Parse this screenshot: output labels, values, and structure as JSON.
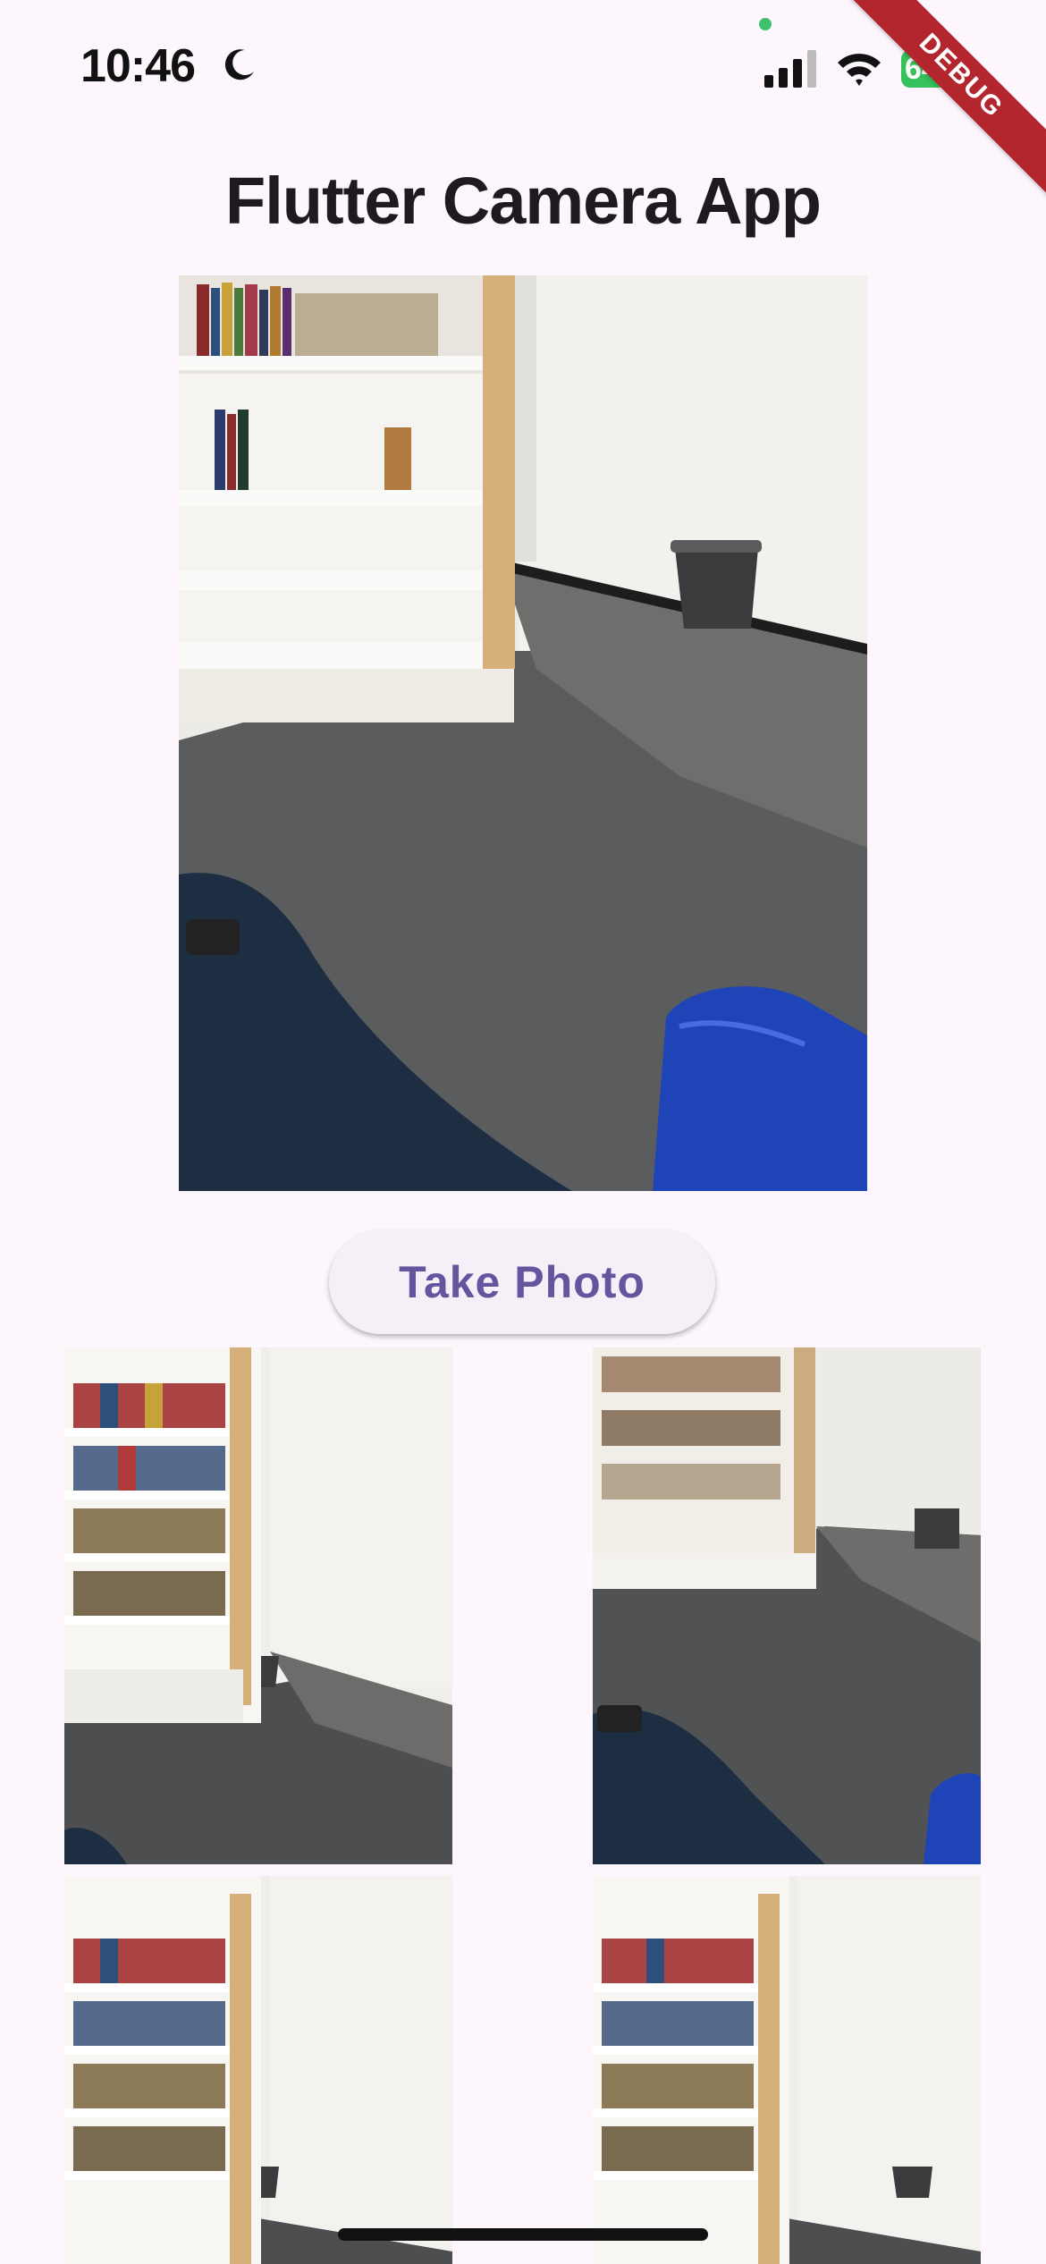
{
  "status_bar": {
    "time": "10:46",
    "battery_percent": "64",
    "battery_level": 0.64,
    "icons": [
      "moon-icon",
      "signal-icon",
      "wifi-icon",
      "battery-icon"
    ],
    "colors": {
      "battery_fill": "#36c25a",
      "dot": "#3fc26b"
    }
  },
  "debug_banner": {
    "label": "DEBUG",
    "color": "#b3262d"
  },
  "app_bar": {
    "title": "Flutter Camera App"
  },
  "camera_preview": {
    "description_icon": "camera-preview"
  },
  "actions": {
    "take_photo_label": "Take Photo"
  },
  "gallery": {
    "photos": [
      {
        "name": "photo-1"
      },
      {
        "name": "photo-2"
      },
      {
        "name": "photo-3"
      },
      {
        "name": "photo-4"
      }
    ]
  },
  "theme": {
    "background": "#fdf7fd",
    "accent": "#65559f",
    "button_bg": "#f5eff7"
  }
}
